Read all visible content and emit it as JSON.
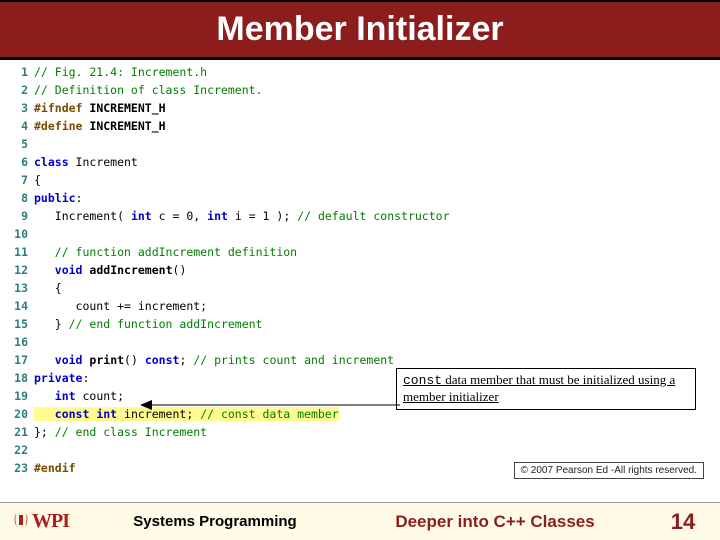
{
  "title": "Member Initializer",
  "callout": {
    "const_kw": "const",
    "rest": " data member that must be initialized using a member initializer"
  },
  "copyright": "© 2007 Pearson Ed -All rights reserved.",
  "footer": {
    "logo": "WPI",
    "left": "Systems Programming",
    "mid": "Deeper into C++ Classes",
    "page": "14"
  },
  "code": [
    {
      "n": "1",
      "plain": "",
      "seg": [
        [
          "c-comment",
          "// Fig. 21.4: Increment.h"
        ]
      ]
    },
    {
      "n": "2",
      "plain": "",
      "seg": [
        [
          "c-comment",
          "// Definition of class Increment."
        ]
      ]
    },
    {
      "n": "3",
      "plain": "",
      "seg": [
        [
          "c-prep",
          "#ifndef "
        ],
        [
          "c-ident",
          "INCREMENT_H"
        ]
      ]
    },
    {
      "n": "4",
      "plain": "",
      "seg": [
        [
          "c-prep",
          "#define "
        ],
        [
          "c-ident",
          "INCREMENT_H"
        ]
      ]
    },
    {
      "n": "5",
      "plain": "",
      "seg": [
        [
          "c-plain",
          " "
        ]
      ]
    },
    {
      "n": "6",
      "plain": "",
      "seg": [
        [
          "c-kw",
          "class "
        ],
        [
          "c-plain",
          "Increment"
        ]
      ]
    },
    {
      "n": "7",
      "plain": "",
      "seg": [
        [
          "c-plain",
          "{"
        ]
      ]
    },
    {
      "n": "8",
      "plain": "",
      "seg": [
        [
          "c-kw",
          "public"
        ],
        [
          "c-plain",
          ":"
        ]
      ]
    },
    {
      "n": "9",
      "plain": "",
      "seg": [
        [
          "c-plain",
          "   Increment( "
        ],
        [
          "c-kw",
          "int"
        ],
        [
          "c-plain",
          " c = "
        ],
        [
          "c-num",
          "0"
        ],
        [
          "c-plain",
          ", "
        ],
        [
          "c-kw",
          "int"
        ],
        [
          "c-plain",
          " i = "
        ],
        [
          "c-num",
          "1"
        ],
        [
          "c-plain",
          " ); "
        ],
        [
          "c-comment",
          "// default constructor"
        ]
      ]
    },
    {
      "n": "10",
      "plain": "",
      "seg": [
        [
          "c-plain",
          " "
        ]
      ]
    },
    {
      "n": "11",
      "plain": "",
      "seg": [
        [
          "c-plain",
          "   "
        ],
        [
          "c-comment",
          "// function addIncrement definition"
        ]
      ]
    },
    {
      "n": "12",
      "plain": "",
      "seg": [
        [
          "c-plain",
          "   "
        ],
        [
          "c-kw",
          "void"
        ],
        [
          "c-plain",
          " "
        ],
        [
          "c-ident",
          "addIncrement"
        ],
        [
          "c-plain",
          "()"
        ]
      ]
    },
    {
      "n": "13",
      "plain": "",
      "seg": [
        [
          "c-plain",
          "   {"
        ]
      ]
    },
    {
      "n": "14",
      "plain": "",
      "seg": [
        [
          "c-plain",
          "      count += increment;"
        ]
      ]
    },
    {
      "n": "15",
      "plain": "",
      "seg": [
        [
          "c-plain",
          "   } "
        ],
        [
          "c-comment",
          "// end function addIncrement"
        ]
      ]
    },
    {
      "n": "16",
      "plain": "",
      "seg": [
        [
          "c-plain",
          " "
        ]
      ]
    },
    {
      "n": "17",
      "plain": "",
      "seg": [
        [
          "c-plain",
          "   "
        ],
        [
          "c-kw",
          "void"
        ],
        [
          "c-plain",
          " "
        ],
        [
          "c-ident",
          "print"
        ],
        [
          "c-plain",
          "() "
        ],
        [
          "c-kw",
          "const"
        ],
        [
          "c-plain",
          "; "
        ],
        [
          "c-comment",
          "// prints count and increment"
        ]
      ]
    },
    {
      "n": "18",
      "plain": "",
      "seg": [
        [
          "c-kw",
          "private"
        ],
        [
          "c-plain",
          ":"
        ]
      ]
    },
    {
      "n": "19",
      "plain": "",
      "seg": [
        [
          "c-plain",
          "   "
        ],
        [
          "c-kw",
          "int"
        ],
        [
          "c-plain",
          " count;"
        ]
      ]
    },
    {
      "n": "20",
      "plain": "",
      "hl": true,
      "seg": [
        [
          "c-plain",
          "   "
        ],
        [
          "c-kw",
          "const int"
        ],
        [
          "c-plain",
          " increment; "
        ],
        [
          "c-comment",
          "// const data member"
        ]
      ]
    },
    {
      "n": "21",
      "plain": "",
      "seg": [
        [
          "c-plain",
          "}; "
        ],
        [
          "c-comment",
          "// end class Increment"
        ]
      ]
    },
    {
      "n": "22",
      "plain": "",
      "seg": [
        [
          "c-plain",
          " "
        ]
      ]
    },
    {
      "n": "23",
      "plain": "",
      "seg": [
        [
          "c-prep",
          "#endif"
        ]
      ]
    }
  ]
}
